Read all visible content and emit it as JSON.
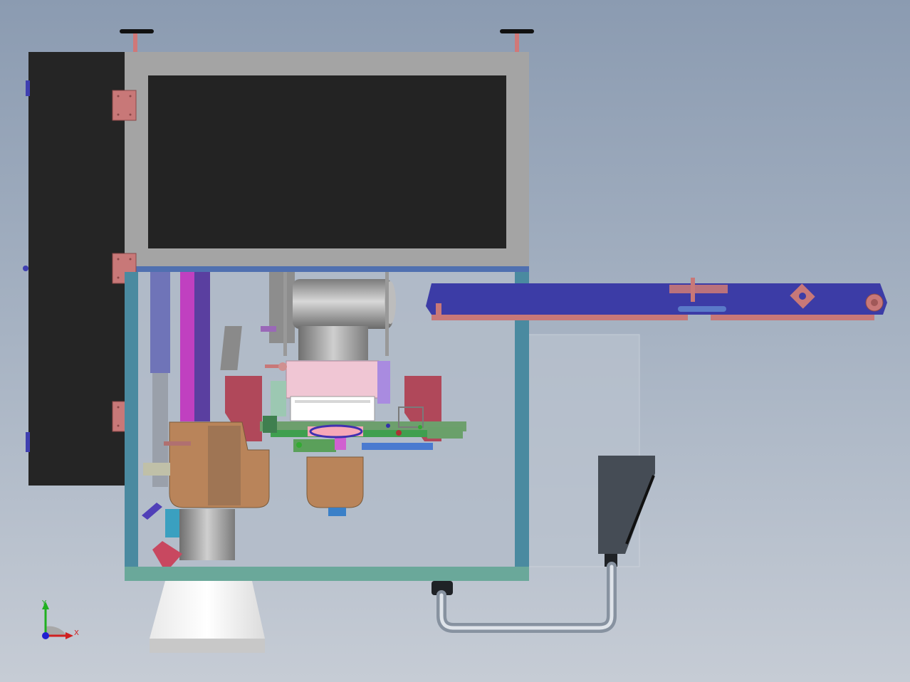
{
  "viewport": {
    "background_top": "#8b9bb1",
    "background_bottom": "#c6ccd5"
  },
  "triad": {
    "x_label": "X",
    "y_label": "Y",
    "x_color": "#d02020",
    "y_color": "#20b020",
    "z_color": "#2020d0"
  },
  "colors": {
    "cabinet_door": "#252525",
    "upper_frame": "#a4a4a4",
    "screen": "#232323",
    "frame_teal": "#4a8aa0",
    "base_teal": "#6aa89a",
    "conveyor": "#3c3ca6",
    "hinge": "#c87878",
    "control_box": "#454c55"
  }
}
